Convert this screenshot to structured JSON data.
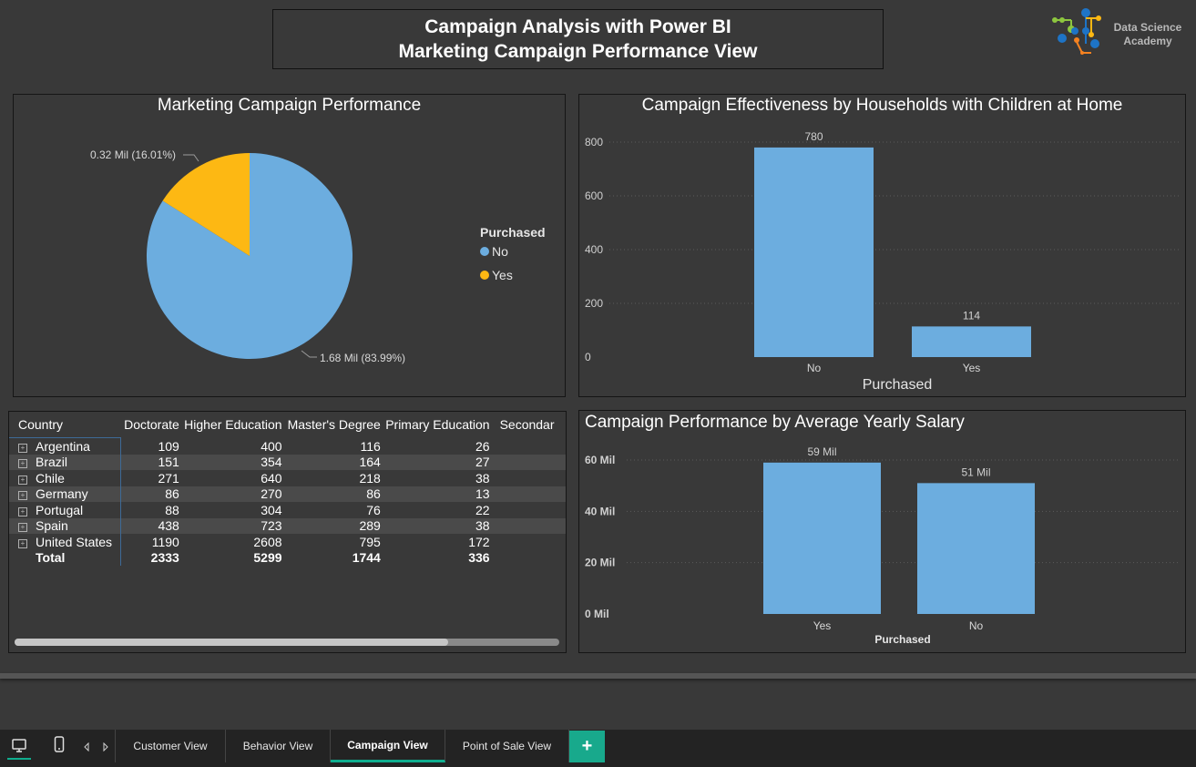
{
  "header": {
    "title_line1": "Campaign Analysis with Power BI",
    "title_line2": "Marketing Campaign Performance View",
    "logo_text": "Data Science Academy"
  },
  "pie_panel": {
    "title": "Marketing Campaign Performance",
    "legend_title": "Purchased",
    "legend": [
      {
        "label": "No",
        "color": "#6caddf"
      },
      {
        "label": "Yes",
        "color": "#fdb813"
      }
    ],
    "labels": {
      "yes": "0.32 Mil (16.01%)",
      "no": "1.68 Mil (83.99%)"
    }
  },
  "children_panel": {
    "title": "Campaign Effectiveness by Households with Children at Home",
    "xlabel": "Purchased",
    "y_ticks": [
      "800",
      "600",
      "400",
      "200",
      "0"
    ]
  },
  "salary_panel": {
    "title": "Campaign Performance by Average Yearly Salary",
    "xlabel": "Purchased",
    "y_ticks": [
      "60 Mil",
      "40 Mil",
      "20 Mil",
      "0 Mil"
    ]
  },
  "matrix": {
    "headers": [
      "Country",
      "Doctorate",
      "Higher Education",
      "Master's Degree",
      "Primary Education",
      "Secondar"
    ],
    "rows": [
      {
        "country": "Argentina",
        "values": [
          "109",
          "400",
          "116",
          "26"
        ]
      },
      {
        "country": "Brazil",
        "values": [
          "151",
          "354",
          "164",
          "27"
        ]
      },
      {
        "country": "Chile",
        "values": [
          "271",
          "640",
          "218",
          "38"
        ]
      },
      {
        "country": "Germany",
        "values": [
          "86",
          "270",
          "86",
          "13"
        ]
      },
      {
        "country": "Portugal",
        "values": [
          "88",
          "304",
          "76",
          "22"
        ]
      },
      {
        "country": "Spain",
        "values": [
          "438",
          "723",
          "289",
          "38"
        ]
      },
      {
        "country": "United States",
        "values": [
          "1190",
          "2608",
          "795",
          "172"
        ]
      }
    ],
    "total": {
      "label": "Total",
      "values": [
        "2333",
        "5299",
        "1744",
        "336"
      ]
    }
  },
  "tabs": {
    "customer": "Customer View",
    "behavior": "Behavior View",
    "campaign": "Campaign View",
    "pos": "Point of Sale View",
    "add": "+"
  },
  "chart_data": [
    {
      "type": "pie",
      "title": "Marketing Campaign Performance",
      "legend_title": "Purchased",
      "categories": [
        "No",
        "Yes"
      ],
      "values": [
        1.68,
        0.32
      ],
      "unit": "Mil",
      "percentages": [
        83.99,
        16.01
      ],
      "colors": [
        "#6caddf",
        "#fdb813"
      ],
      "legend_position": "right"
    },
    {
      "type": "bar",
      "title": "Campaign Effectiveness by Households with Children at Home",
      "categories": [
        "No",
        "Yes"
      ],
      "values": [
        780,
        114
      ],
      "xlabel": "Purchased",
      "ylabel": "",
      "ylim": [
        0,
        800
      ],
      "color": "#6caddf",
      "grid": true
    },
    {
      "type": "bar",
      "title": "Campaign Performance by Average Yearly Salary",
      "categories": [
        "Yes",
        "No"
      ],
      "values": [
        59,
        51
      ],
      "value_labels": [
        "59 Mil",
        "51 Mil"
      ],
      "xlabel": "Purchased",
      "ylabel": "",
      "ylim": [
        0,
        60
      ],
      "unit": "Mil",
      "color": "#6caddf",
      "grid": true
    },
    {
      "type": "table",
      "columns": [
        "Country",
        "Doctorate",
        "Higher Education",
        "Master's Degree",
        "Primary Education",
        "Secondar"
      ],
      "rows": [
        [
          "Argentina",
          109,
          400,
          116,
          26
        ],
        [
          "Brazil",
          151,
          354,
          164,
          27
        ],
        [
          "Chile",
          271,
          640,
          218,
          38
        ],
        [
          "Germany",
          86,
          270,
          86,
          13
        ],
        [
          "Portugal",
          88,
          304,
          76,
          22
        ],
        [
          "Spain",
          438,
          723,
          289,
          38
        ],
        [
          "United States",
          1190,
          2608,
          795,
          172
        ],
        [
          "Total",
          2333,
          5299,
          1744,
          336
        ]
      ]
    }
  ]
}
